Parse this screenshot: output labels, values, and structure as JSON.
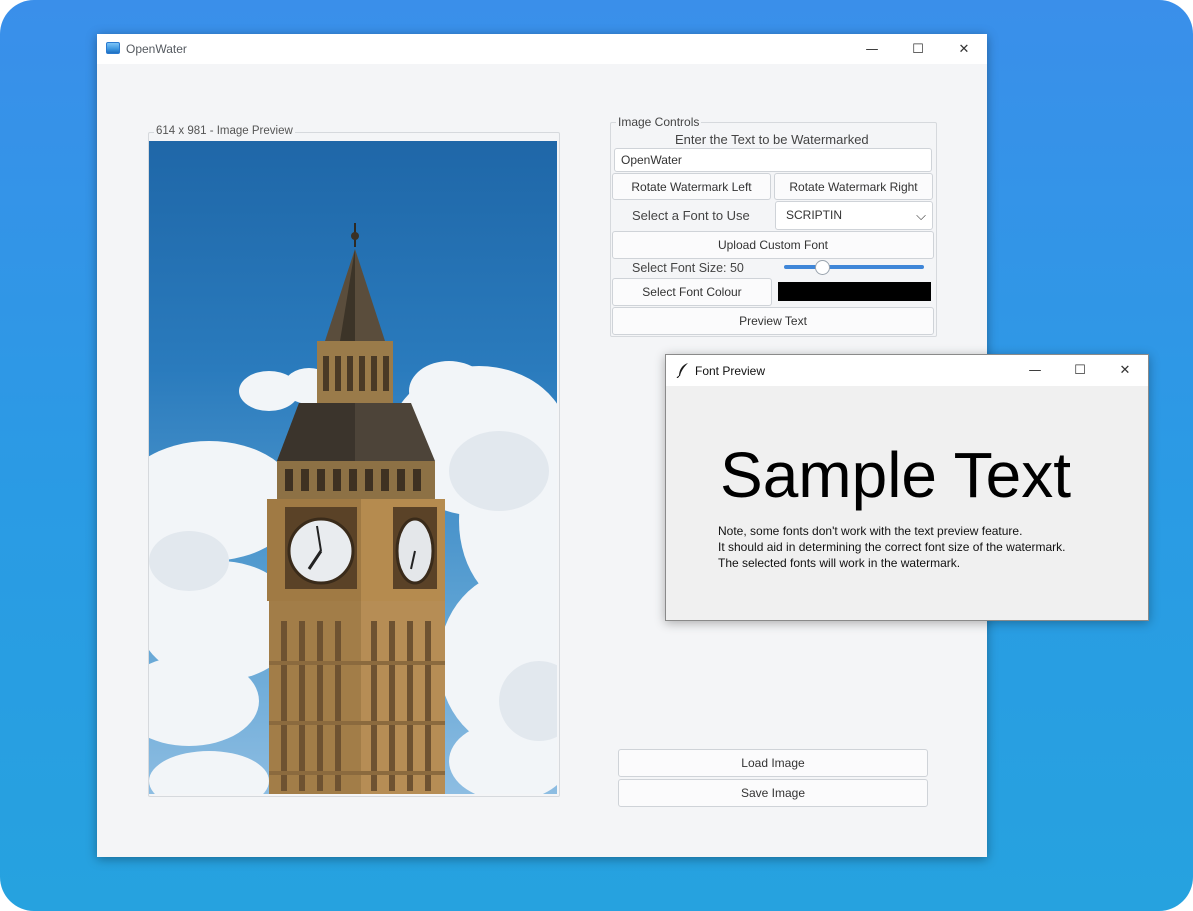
{
  "main_window": {
    "title": "OpenWater",
    "controls": {
      "minimize": "—",
      "maximize": "☐",
      "close": "✕"
    }
  },
  "image_preview": {
    "legend": "614 x 981 - Image Preview"
  },
  "image_controls": {
    "legend": "Image Controls",
    "watermark_prompt": "Enter the Text to be Watermarked",
    "watermark_text": "OpenWater",
    "rotate_left_label": "Rotate Watermark Left",
    "rotate_right_label": "Rotate Watermark Right",
    "font_prompt": "Select a Font to Use",
    "font_selected": "SCRIPTIN",
    "upload_font_label": "Upload Custom Font",
    "font_size_label": "Select Font Size: 50",
    "font_size_value": 50,
    "font_colour_label": "Select Font Colour",
    "font_colour": "#000000",
    "preview_text_label": "Preview Text"
  },
  "actions": {
    "load_label": "Load Image",
    "save_label": "Save Image"
  },
  "font_preview": {
    "title": "Font Preview",
    "sample": "Sample Text",
    "note_lines": [
      "Note, some fonts don't work with the text preview feature.",
      "It should aid in determining the correct font size of the watermark.",
      "The selected fonts will work in the watermark."
    ],
    "controls": {
      "minimize": "—",
      "maximize": "☐",
      "close": "✕"
    }
  }
}
